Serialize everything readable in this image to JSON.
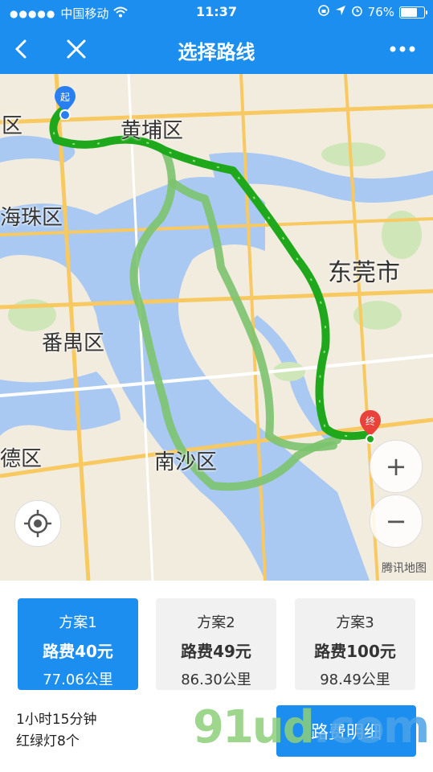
{
  "status_bar": {
    "carrier": "中国移动",
    "time": "11:37",
    "battery": "76%",
    "battery_level": 0.76
  },
  "nav": {
    "title": "选择路线"
  },
  "map": {
    "labels": {
      "qu_left": "区",
      "huangpu": "黄埔区",
      "haizhu": "海珠区",
      "dongguan": "东莞市",
      "panyu": "番禺区",
      "shunde": "德区",
      "nansha": "南沙区"
    },
    "start_marker": "起",
    "end_marker": "终",
    "zoom_in": "+",
    "zoom_out": "−",
    "logo": "腾讯地图"
  },
  "plans": [
    {
      "name": "方案1",
      "fee": "路费40元",
      "distance": "77.06公里",
      "active": true
    },
    {
      "name": "方案2",
      "fee": "路费49元",
      "distance": "86.30公里",
      "active": false
    },
    {
      "name": "方案3",
      "fee": "路费100元",
      "distance": "98.49公里",
      "active": false
    }
  ],
  "summary": {
    "duration": "1小时15分钟",
    "traffic_lights": "红绿灯8个"
  },
  "detail_button": "路费明细",
  "watermark": {
    "text": "91ud",
    "suffix": ".com"
  },
  "colors": {
    "primary": "#1b8ef0",
    "route_main": "#1fa81c",
    "route_alt": "#7cc36e",
    "water": "#a9c9f2",
    "land": "#f2ecdf",
    "road_major": "#f7c960"
  }
}
